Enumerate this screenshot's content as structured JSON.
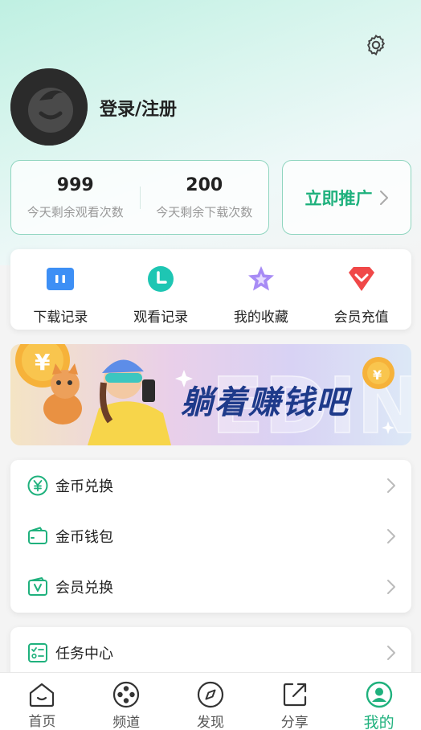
{
  "header": {
    "login_label": "登录/注册",
    "settings_icon": "gear-icon"
  },
  "stats": [
    {
      "value": "999",
      "label": "今天剩余观看次数"
    },
    {
      "value": "200",
      "label": "今天剩余下载次数"
    }
  ],
  "promote": {
    "label": "立即推广"
  },
  "quick_actions": [
    {
      "label": "下载记录",
      "icon": "download-record-icon",
      "color": "#3d8ff5"
    },
    {
      "label": "观看记录",
      "icon": "clock-icon",
      "color": "#1ec6b3"
    },
    {
      "label": "我的收藏",
      "icon": "star-icon",
      "color": "#a78bf5"
    },
    {
      "label": "会员充值",
      "icon": "heart-gem-icon",
      "color": "#f04848"
    }
  ],
  "banner": {
    "text": "躺着赚钱吧",
    "watermark": "EDINT"
  },
  "menu_primary": [
    {
      "label": "金币兑换",
      "icon": "yen-coin-icon"
    },
    {
      "label": "金币钱包",
      "icon": "wallet-icon"
    },
    {
      "label": "会员兑换",
      "icon": "vip-card-icon"
    }
  ],
  "menu_secondary": [
    {
      "label": "任务中心",
      "icon": "task-list-icon"
    }
  ],
  "tabs": [
    {
      "label": "首页",
      "icon": "home-icon",
      "active": false
    },
    {
      "label": "频道",
      "icon": "film-reel-icon",
      "active": false
    },
    {
      "label": "发现",
      "icon": "compass-icon",
      "active": false
    },
    {
      "label": "分享",
      "icon": "share-icon",
      "active": false
    },
    {
      "label": "我的",
      "icon": "profile-icon",
      "active": true
    }
  ],
  "colors": {
    "accent": "#1fb17d",
    "border_accent": "#8fd5bf"
  }
}
